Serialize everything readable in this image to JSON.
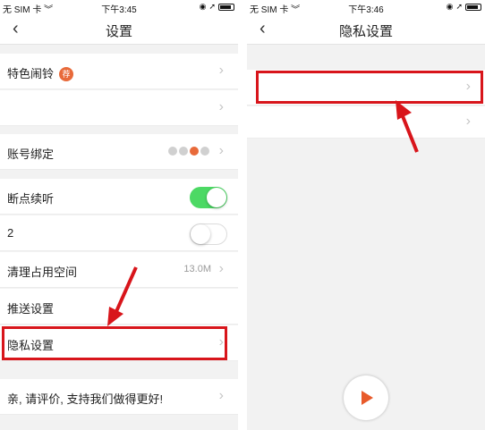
{
  "left": {
    "status": {
      "carrier": "无 SIM 卡 ",
      "time": "下午3:45"
    },
    "nav": {
      "back": "‹",
      "title": "设置"
    },
    "rows": {
      "ringtone": {
        "label": "特色闹铃",
        "badge": "荐"
      },
      "account": {
        "label": "账号绑定"
      },
      "resume": {
        "label": "断点续听"
      },
      "second": {
        "label": "2"
      },
      "cache": {
        "label": "清理占用空间",
        "value": "13.0M"
      },
      "push": {
        "label": "推送设置"
      },
      "privacy": {
        "label": "隐私设置"
      },
      "rate": {
        "label": "亲, 请评价, 支持我们做得更好!"
      }
    },
    "switches": {
      "resume": "on",
      "second": "off"
    }
  },
  "right": {
    "status": {
      "carrier": "无 SIM 卡 ",
      "time": "下午3:46"
    },
    "nav": {
      "back": "‹",
      "title": "隐私设置"
    }
  },
  "colors": {
    "accent": "#d8151b",
    "switch_on": "#4cd964",
    "badge": "#e86a3a"
  }
}
